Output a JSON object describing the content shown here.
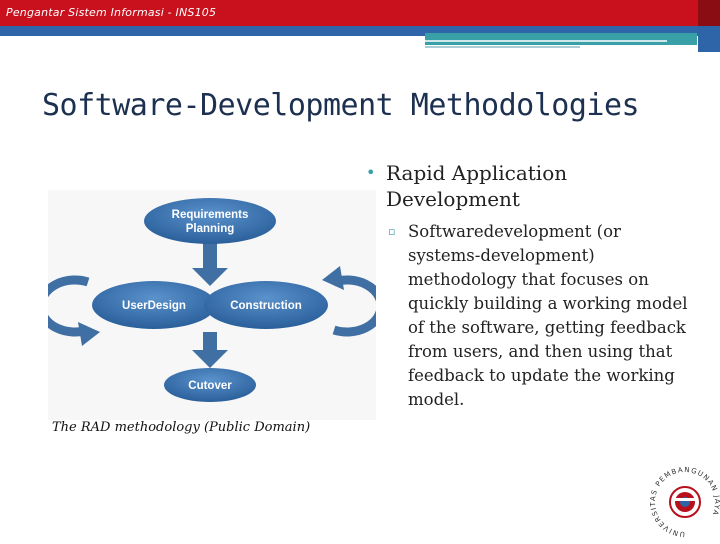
{
  "header": {
    "course": "Pengantar Sistem Informasi - INS105"
  },
  "slide": {
    "title": "Software-Development Methodologies",
    "bullet_main": "Rapid Application Development",
    "bullet_sub": "Softwaredevelopment (or systems-development) methodology that focuses on quickly building a working model of the software, getting feedback from users, and then using that feedback to update the working model."
  },
  "diagram": {
    "nodes": {
      "requirements_line1": "Requirements",
      "requirements_line2": "Planning",
      "user_design": "UserDesign",
      "construction": "Construction",
      "cutover": "Cutover"
    },
    "caption": "The RAD methodology (Public Domain)"
  },
  "logo": {
    "ring_text": "UNIVERSITAS PEMBANGUNAN JAYA"
  },
  "colors": {
    "header_red": "#c8111d",
    "band_blue": "#2e65a8",
    "accent_teal": "#3aa0a8",
    "node_blue": "#2d6ca8",
    "title_navy": "#1d3050"
  }
}
